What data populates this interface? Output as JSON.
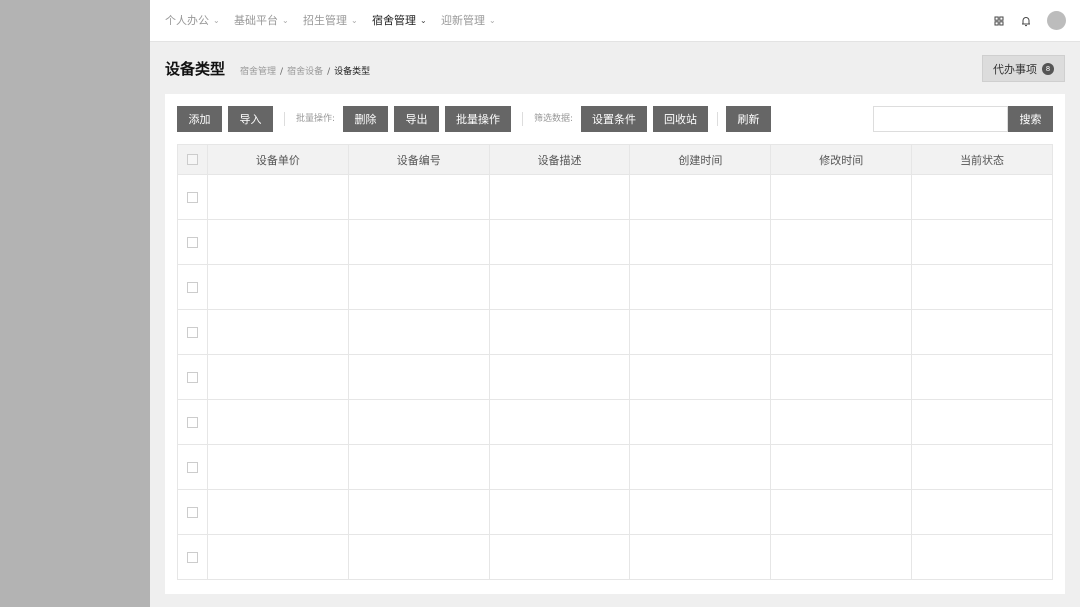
{
  "topnav": {
    "items": [
      {
        "label": "个人办公"
      },
      {
        "label": "基础平台"
      },
      {
        "label": "招生管理"
      },
      {
        "label": "宿舍管理",
        "active": true
      },
      {
        "label": "迎新管理"
      }
    ],
    "icons": [
      "apps-grid-icon",
      "bell-icon",
      "avatar"
    ]
  },
  "page": {
    "title": "设备类型",
    "breadcrumb": [
      "宿舍管理",
      "宿舍设备",
      "设备类型"
    ],
    "breadcrumb_sep": "/",
    "todo": {
      "label": "代办事项",
      "count": "8"
    }
  },
  "toolbar": {
    "add": "添加",
    "import": "导入",
    "batch_label": "批量操作:",
    "delete": "删除",
    "export": "导出",
    "batch_op": "批量操作",
    "filter_label": "筛选数据:",
    "set_condition": "设置条件",
    "recycle": "回收站",
    "refresh": "刷新",
    "search_value": "",
    "search": "搜索"
  },
  "table": {
    "columns": [
      "设备单价",
      "设备编号",
      "设备描述",
      "创建时间",
      "修改时间",
      "当前状态"
    ],
    "rows": [
      [
        "",
        "",
        "",
        "",
        "",
        ""
      ],
      [
        "",
        "",
        "",
        "",
        "",
        ""
      ],
      [
        "",
        "",
        "",
        "",
        "",
        ""
      ],
      [
        "",
        "",
        "",
        "",
        "",
        ""
      ],
      [
        "",
        "",
        "",
        "",
        "",
        ""
      ],
      [
        "",
        "",
        "",
        "",
        "",
        ""
      ],
      [
        "",
        "",
        "",
        "",
        "",
        ""
      ],
      [
        "",
        "",
        "",
        "",
        "",
        ""
      ],
      [
        "",
        "",
        "",
        "",
        "",
        ""
      ]
    ]
  },
  "colors": {
    "sidebar": "#b3b3b3",
    "button": "#666666",
    "panel": "#ffffff",
    "background": "#efefef"
  }
}
